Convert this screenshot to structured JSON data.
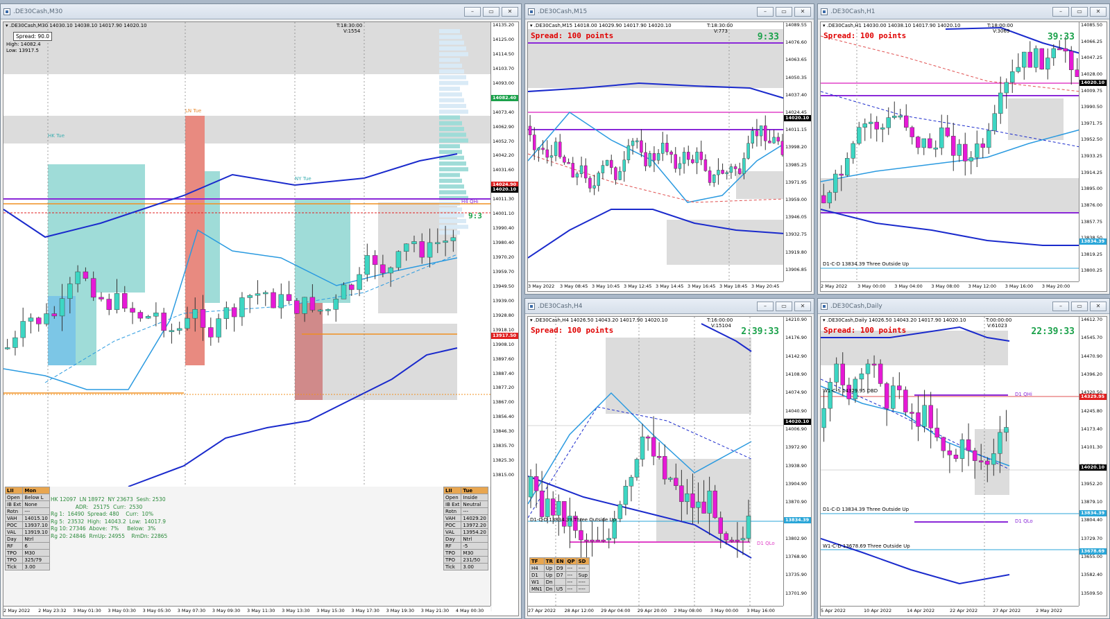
{
  "windows": {
    "m30": {
      "title": ".DE30Cash,M30",
      "header": ".DE30Cash,M30  14030.10 14038.10 14017.90 14020.10",
      "vol": "V:1554",
      "time_label": "T:18:30:00",
      "spread_box": "Spread: 90.0",
      "high": "High: 14082.4",
      "low": "Low: 13917.5",
      "timer": "9:3",
      "price_ticks": [
        "14135.20",
        "14125.00",
        "14114.50",
        "14103.70",
        "14093.00",
        "14082.40",
        "14073.40",
        "14062.90",
        "14052.70",
        "14042.20",
        "14031.60",
        "14021.10",
        "14011.30",
        "14001.10",
        "13990.40",
        "13980.40",
        "13970.20",
        "13959.70",
        "13949.50",
        "13939.00",
        "13928.80",
        "13918.10",
        "13908.10",
        "13897.60",
        "13887.40",
        "13877.20",
        "13867.00",
        "13856.40",
        "13846.30",
        "13835.70",
        "13825.30",
        "13815.00"
      ],
      "price_flags": [
        {
          "text": "14082.40",
          "color": "#1aa14a",
          "tick": 5
        },
        {
          "text": "14024.90",
          "color": "#e02020",
          "tick": 11
        },
        {
          "text": "14020.10",
          "color": "#000000",
          "tick": 11.3
        },
        {
          "text": "13917.50",
          "color": "#e02020",
          "tick": 21.4
        }
      ],
      "time_ticks": [
        "2 May 2022",
        "2 May 23:32",
        "3 May 01:30",
        "3 May 03:30",
        "3 May 05:30",
        "3 May 07:30",
        "3 May 09:30",
        "3 May 11:30",
        "3 May 13:30",
        "3 May 15:30",
        "3 May 17:30",
        "3 May 19:30",
        "3 May 21:30",
        "4 May 00:30"
      ],
      "labels": {
        "hk": "HK Tue",
        "ln": "LN Tue",
        "ny": "NY Tue",
        "h4": "H4 QHi"
      },
      "left_table": [
        [
          "LII",
          "Mon"
        ],
        [
          "Open",
          "Below L"
        ],
        [
          "IB Ext",
          "None"
        ],
        [
          "Rotn",
          "---"
        ],
        [
          "VAH",
          "14015.10"
        ],
        [
          "POC",
          "13937.10"
        ],
        [
          "VAL",
          "13919.10"
        ],
        [
          "Day",
          "Ntrl"
        ],
        [
          "RF",
          "6"
        ],
        [
          "TPO",
          "M30"
        ],
        [
          "TPO",
          "325/79"
        ],
        [
          "Tick",
          "3.00"
        ]
      ],
      "right_table": [
        [
          "LII",
          "Tue"
        ],
        [
          "Open",
          "Inside"
        ],
        [
          "IB Ext",
          "Neutral"
        ],
        [
          "Rotn",
          "---"
        ],
        [
          "VAH",
          "14029.20"
        ],
        [
          "POC",
          "13972.20"
        ],
        [
          "VAL",
          "13954.20"
        ],
        [
          "Day",
          "Ntrl"
        ],
        [
          "RF",
          "-5"
        ],
        [
          "TPO",
          "M30"
        ],
        [
          "TPO",
          "231/50"
        ],
        [
          "Tick",
          "3.00"
        ]
      ],
      "info_lines": [
        "HK 12097  LN 18972  NY 23673  Sesh: 2530",
        "               ADR:   25175  Curr:  2530",
        "Rg 1:  16490  Spread: 480    Curr:  10%",
        "Rg 5:  23532  High:  14043.2  Low:  14017.9",
        "Rg 10: 27346  Above:  7%     Below:  3%",
        "Rg 20: 24846  RmUp: 24955    RmDn: 22865"
      ]
    },
    "m15": {
      "title": ".DE30Cash,M15",
      "header": ".DE30Cash,M15  14018.00 14029.90 14017.90 14020.10",
      "vol": "V:773",
      "time_label": "T:18:30:00",
      "spread": "Spread: 100 points",
      "timer": "9:33",
      "price_ticks": [
        "14089.55",
        "14076.60",
        "14063.65",
        "14050.35",
        "14037.40",
        "14024.45",
        "14011.15",
        "13998.20",
        "13985.25",
        "13971.95",
        "13959.00",
        "13946.05",
        "13932.75",
        "13919.80",
        "13906.85"
      ],
      "price_flags": [
        {
          "text": "14020.10",
          "color": "#000000",
          "tick": 5.3
        }
      ],
      "time_ticks": [
        "3 May 2022",
        "3 May 08:45",
        "3 May 10:45",
        "3 May 12:45",
        "3 May 14:45",
        "3 May 16:45",
        "3 May 18:45",
        "3 May 20:45"
      ]
    },
    "h1": {
      "title": ".DE30Cash,H1",
      "header": ".DE30Cash,H1  14030.00 14038.10 14017.90 14020.10",
      "vol": "V:3069",
      "time_label": "T:18:00:00",
      "spread": "Spread: 100 points",
      "timer": "39:33",
      "price_ticks": [
        "14085.50",
        "14066.25",
        "14047.25",
        "14028.00",
        "14009.75",
        "13990.50",
        "13971.75",
        "13952.50",
        "13933.25",
        "13914.25",
        "13895.00",
        "13876.00",
        "13857.75",
        "13838.50",
        "13819.25",
        "13800.25"
      ],
      "price_flags": [
        {
          "text": "14020.10",
          "color": "#000000",
          "tick": 3.5
        },
        {
          "text": "13834.39",
          "color": "#2aa6d8",
          "tick": 13.2
        }
      ],
      "time_ticks": [
        "2 May 2022",
        "3 May 00:00",
        "3 May 04:00",
        "3 May 08:00",
        "3 May 12:00",
        "3 May 16:00",
        "3 May 20:00"
      ],
      "pattern_label": "D1-C-D 13834.39 Three Outside Up"
    },
    "h4": {
      "title": ".DE30Cash,H4",
      "header": ".DE30Cash,H4  14026.50 14043.20 14017.90 14020.10",
      "vol": "V:15104",
      "time_label": "T:16:00:00",
      "spread": "Spread: 100 points",
      "timer": "2:39:33",
      "price_ticks": [
        "14210.90",
        "14176.90",
        "14142.90",
        "14108.90",
        "14074.90",
        "14040.90",
        "14006.90",
        "13972.90",
        "13938.90",
        "13904.90",
        "13870.90",
        "13836.90",
        "13802.90",
        "13768.90",
        "13735.90",
        "13701.90"
      ],
      "price_flags": [
        {
          "text": "14020.10",
          "color": "#000000",
          "tick": 5.6
        },
        {
          "text": "13834.39",
          "color": "#2aa6d8",
          "tick": 11
        }
      ],
      "time_ticks": [
        "27 Apr 2022",
        "28 Apr 12:00",
        "29 Apr 04:00",
        "29 Apr 20:00",
        "2 May 08:00",
        "3 May 00:00",
        "3 May 16:00"
      ],
      "pattern_label": "D1-C-D 13834.39 Three Outside Up",
      "d1qlo": "D1 QLo",
      "trend_table": [
        [
          "TF",
          "TR",
          "EN",
          "QP",
          "SD"
        ],
        [
          "H4",
          "Up",
          "D9",
          "---",
          "----"
        ],
        [
          "D1",
          "Up",
          "D7",
          "---",
          "Sup"
        ],
        [
          "W1",
          "Dn",
          "",
          "---",
          "----"
        ],
        [
          "MN1",
          "Dn",
          "U5",
          "---",
          "----"
        ]
      ]
    },
    "daily": {
      "title": ".DE30Cash,Daily",
      "header": ".DE30Cash,Daily  14026.50 14043.20 14017.90 14020.10",
      "vol": "V:61023",
      "time_label": "T:00:00:00",
      "spread": "Spread: 100 points",
      "timer": "22:39:33",
      "price_ticks": [
        "14612.70",
        "14545.70",
        "14470.90",
        "14396.20",
        "14320.50",
        "14245.80",
        "14173.40",
        "14101.30",
        "14024.30",
        "13952.20",
        "13879.10",
        "13804.40",
        "13729.70",
        "13655.00",
        "13582.40",
        "13509.50"
      ],
      "price_flags": [
        {
          "text": "14329.95",
          "color": "#e02020",
          "tick": 4.2
        },
        {
          "text": "14020.10",
          "color": "#000000",
          "tick": 8.1
        },
        {
          "text": "13834.39",
          "color": "#2aa6d8",
          "tick": 10.6
        },
        {
          "text": "13678.69",
          "color": "#2aa6d8",
          "tick": 12.7
        }
      ],
      "time_ticks": [
        "5 Apr 2022",
        "10 Apr 2022",
        "14 Apr 2022",
        "22 Apr 2022",
        "27 Apr 2022",
        "2 May 2022"
      ],
      "d1qhi": "D1 QHi",
      "d1qlo": "D1 QLo",
      "label_d": "W1-C-S 14329.95 DBD",
      "pattern_label": "D1-C-D 13834.39 Three Outside Up",
      "pattern_label2": "W1-C-D 13678.69 Three Outside Up"
    }
  },
  "colors": {
    "bull": "#3dd6c3",
    "bear": "#e619d6",
    "band": "#1a2acc",
    "ma": "#2a9ae0",
    "level": "#8a28d8",
    "qhi": "#e040c8"
  }
}
